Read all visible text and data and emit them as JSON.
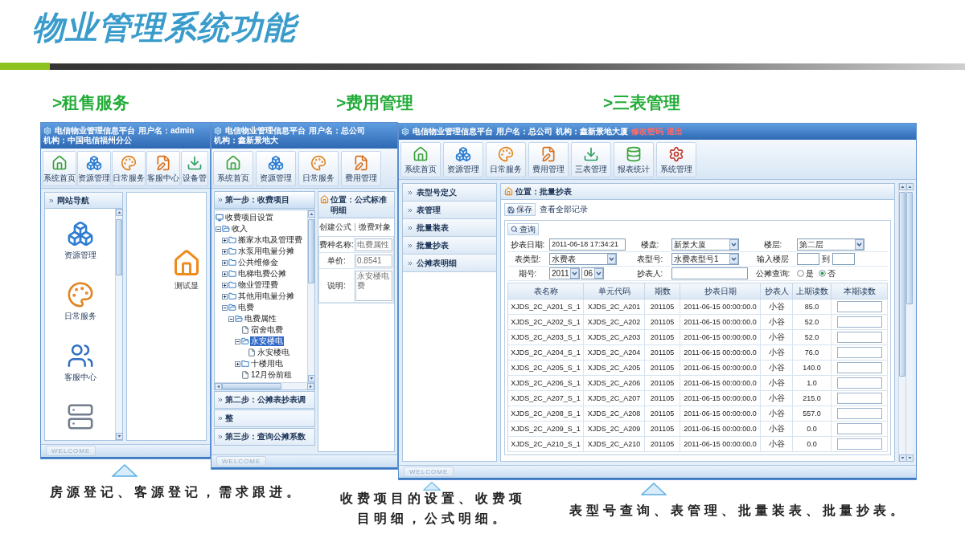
{
  "slide_title": "物业管理系统功能",
  "sections": [
    {
      "heading": ">租售服务",
      "caption": "房源登记、客源登记，需求跟进。"
    },
    {
      "heading": ">费用管理",
      "caption": "收费项目的设置、收费项目明细，公式明细。"
    },
    {
      "heading": ">三表管理",
      "caption": "表型号查询、表管理、批量装表、批量抄表。"
    }
  ],
  "rental_window": {
    "title_bar": {
      "platform": "电信物业管理信息平台",
      "user": "用户名：admin",
      "org": "机构：中国电信福州分公"
    },
    "toolbar": [
      "系统首页",
      "资源管理",
      "日常服务",
      "客服中心",
      "设备管"
    ],
    "nav": {
      "title": "网站导航",
      "items": [
        "资源管理",
        "日常服务",
        "客服中心"
      ]
    },
    "main_label": "测试显",
    "status_button": "WELCOME"
  },
  "fee_window": {
    "title_bar": {
      "platform": "电信物业管理信息平台",
      "user": "用户名：总公司",
      "org": "机构：鑫新景地大"
    },
    "toolbar": [
      "系统首页",
      "资源管理",
      "日常服务",
      "费用管理"
    ],
    "steps": [
      {
        "label": "第一步：收费项目",
        "expanded": true
      },
      {
        "label": "第二步：公摊表抄表调",
        "expanded": false
      },
      {
        "label": "整",
        "expanded": false
      },
      {
        "label": "第三步：查询公摊系数",
        "expanded": false
      }
    ],
    "tree": {
      "label": "收费项目设置",
      "kind": "root",
      "selected": false,
      "children": [
        {
          "label": "收入",
          "kind": "folder",
          "expanded": true,
          "selected": false,
          "children": [
            {
              "label": "搬家水电及管理费",
              "kind": "folder",
              "expanded": false,
              "selected": false
            },
            {
              "label": "水泵用电量分摊",
              "kind": "folder",
              "expanded": false,
              "selected": false
            },
            {
              "label": "公共维修金",
              "kind": "folder",
              "expanded": false,
              "selected": false
            },
            {
              "label": "电梯电费公摊",
              "kind": "folder",
              "expanded": false,
              "selected": false
            },
            {
              "label": "物业管理费",
              "kind": "folder",
              "expanded": false,
              "selected": false
            },
            {
              "label": "其他用电量分摊",
              "kind": "folder",
              "expanded": false,
              "selected": false
            },
            {
              "label": "电费",
              "kind": "folder",
              "expanded": true,
              "selected": false,
              "children": [
                {
                  "label": "电费属性",
                  "kind": "folder",
                  "expanded": true,
                  "selected": false,
                  "children": [
                    {
                      "label": "宿舍电费",
                      "kind": "leaf",
                      "selected": false
                    },
                    {
                      "label": "永安楼电",
                      "kind": "folder",
                      "expanded": true,
                      "selected": true,
                      "children": [
                        {
                          "label": "永安楼电",
                          "kind": "leaf",
                          "selected": false
                        }
                      ]
                    },
                    {
                      "label": "十楼用电",
                      "kind": "folder",
                      "expanded": false,
                      "selected": false
                    },
                    {
                      "label": "12月份前租",
                      "kind": "leaf",
                      "selected": false
                    }
                  ]
                }
              ]
            }
          ]
        }
      ]
    },
    "location": "位置：公式标准明细",
    "links": [
      "创建公式",
      "缴费对象"
    ],
    "form": [
      {
        "label": "费种名称:",
        "value": "电费属性",
        "kind": "text"
      },
      {
        "label": "单价:",
        "value": "0.8541",
        "kind": "text"
      },
      {
        "label": "说明:",
        "value": "永安楼电费",
        "kind": "textarea"
      }
    ],
    "status_button": "WELCOME"
  },
  "meter_window": {
    "title_bar": {
      "platform": "电信物业管理信息平台",
      "user": "用户名：总公司",
      "org": "机构：鑫新景地大厦",
      "links": [
        "修改密码",
        "退出"
      ]
    },
    "toolbar": [
      "系统首页",
      "资源管理",
      "日常服务",
      "费用管理",
      "三表管理",
      "报表统计",
      "系统管理"
    ],
    "nav": [
      "表型号定义",
      "表管理",
      "批量装表",
      "批量抄表",
      "公摊表明细"
    ],
    "location": "位置：批量抄表",
    "actions": {
      "save": "保存",
      "view_all": "查看全部记录"
    },
    "query": {
      "tab": "查询",
      "rows": [
        [
          {
            "label": "抄表日期:",
            "kind": "text",
            "value": "2011-06-18 17:34:21"
          },
          {
            "label": "楼盘:",
            "kind": "select",
            "value": "新景大厦"
          },
          {
            "label": "楼层:",
            "kind": "select",
            "value": "第二层"
          }
        ],
        [
          {
            "label": "表类型:",
            "kind": "select",
            "value": "水费表"
          },
          {
            "label": "表型号:",
            "kind": "select",
            "value": "水费表型号1"
          },
          {
            "label": "输入楼层",
            "kind": "range",
            "separator": "到"
          }
        ],
        [
          {
            "label": "期号:",
            "kind": "select_pair",
            "values": [
              "2011",
              "06"
            ]
          },
          {
            "label": "抄表人:",
            "kind": "text"
          },
          {
            "label": "公摊查询:",
            "kind": "radio",
            "options": [
              {
                "label": "是",
                "selected": false
              },
              {
                "label": "否",
                "selected": true
              }
            ]
          }
        ]
      ]
    },
    "table": {
      "columns": [
        "表名称",
        "单元代码",
        "期数",
        "抄表日期",
        "抄表人",
        "上期读数",
        "本期读数"
      ],
      "rows": [
        {
          "meter": "XJDS_2C_A201_S_1",
          "unit": "XJDS_2C_A201",
          "period": "201105",
          "date": "2011-06-15 00:00:00.0",
          "reader": "小谷",
          "previous": "85.0"
        },
        {
          "meter": "XJDS_2C_A202_S_1",
          "unit": "XJDS_2C_A202",
          "period": "201105",
          "date": "2011-06-15 00:00:00.0",
          "reader": "小谷",
          "previous": "52.0"
        },
        {
          "meter": "XJDS_2C_A203_S_1",
          "unit": "XJDS_2C_A203",
          "period": "201105",
          "date": "2011-06-15 00:00:00.0",
          "reader": "小谷",
          "previous": "52.0"
        },
        {
          "meter": "XJDS_2C_A204_S_1",
          "unit": "XJDS_2C_A204",
          "period": "201105",
          "date": "2011-06-15 00:00:00.0",
          "reader": "小谷",
          "previous": "76.0"
        },
        {
          "meter": "XJDS_2C_A205_S_1",
          "unit": "XJDS_2C_A205",
          "period": "201105",
          "date": "2011-06-15 00:00:00.0",
          "reader": "小谷",
          "previous": "140.0"
        },
        {
          "meter": "XJDS_2C_A206_S_1",
          "unit": "XJDS_2C_A206",
          "period": "201105",
          "date": "2011-06-15 00:00:00.0",
          "reader": "小谷",
          "previous": "1.0"
        },
        {
          "meter": "XJDS_2C_A207_S_1",
          "unit": "XJDS_2C_A207",
          "period": "201105",
          "date": "2011-06-15 00:00:00.0",
          "reader": "小谷",
          "previous": "215.0"
        },
        {
          "meter": "XJDS_2C_A208_S_1",
          "unit": "XJDS_2C_A208",
          "period": "201105",
          "date": "2011-06-15 00:00:00.0",
          "reader": "小谷",
          "previous": "557.0"
        },
        {
          "meter": "XJDS_2C_A209_S_1",
          "unit": "XJDS_2C_A209",
          "period": "201105",
          "date": "2011-06-15 00:00:00.0",
          "reader": "小谷",
          "previous": "0.0"
        },
        {
          "meter": "XJDS_2C_A210_S_1",
          "unit": "XJDS_2C_A210",
          "period": "201105",
          "date": "2011-06-15 00:00:00.0",
          "reader": "小谷",
          "previous": "0.0"
        }
      ]
    },
    "status_button": "WELCOME"
  }
}
